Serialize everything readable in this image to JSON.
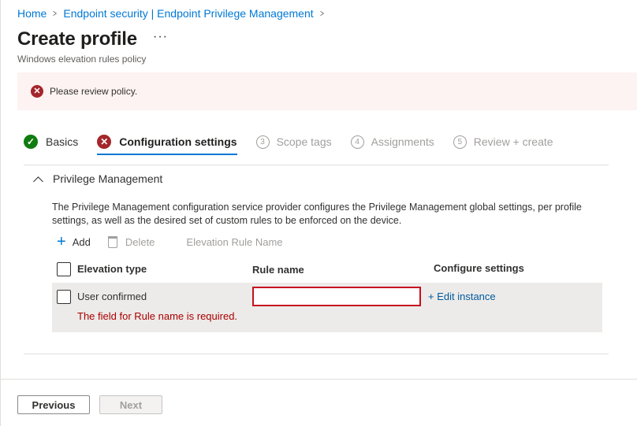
{
  "breadcrumb": {
    "home": "Home",
    "item2": "Endpoint security | Endpoint Privilege Management"
  },
  "header": {
    "title": "Create profile",
    "more": "···",
    "subtitle": "Windows elevation rules policy"
  },
  "banner": {
    "message": "Please review policy.",
    "icon": "error-circle-icon"
  },
  "tabs": [
    {
      "label": "Basics",
      "status": "complete"
    },
    {
      "label": "Configuration settings",
      "status": "error",
      "active": true
    },
    {
      "number": "3",
      "label": "Scope tags",
      "status": "disabled"
    },
    {
      "number": "4",
      "label": "Assignments",
      "status": "disabled"
    },
    {
      "number": "5",
      "label": "Review + create",
      "status": "disabled"
    }
  ],
  "section": {
    "title": "Privilege Management",
    "description": "The Privilege Management configuration service provider configures the Privilege Management global settings, per profile settings, as well as the desired set of custom rules to be enforced on the device."
  },
  "toolbar": {
    "add": "Add",
    "delete": "Delete",
    "column_hint": "Elevation Rule Name"
  },
  "table": {
    "columns": [
      "Elevation type",
      "Rule name",
      "Configure settings"
    ],
    "rows": [
      {
        "elevation_type": "User confirmed",
        "rule_name": "",
        "configure": "+ Edit instance",
        "error": "The field for Rule name is required."
      }
    ]
  },
  "footer": {
    "previous": "Previous",
    "next": "Next"
  },
  "colors": {
    "accent": "#0078d4",
    "error": "#a4262c",
    "success": "#107c10",
    "banner_bg": "#fdf3f2"
  }
}
